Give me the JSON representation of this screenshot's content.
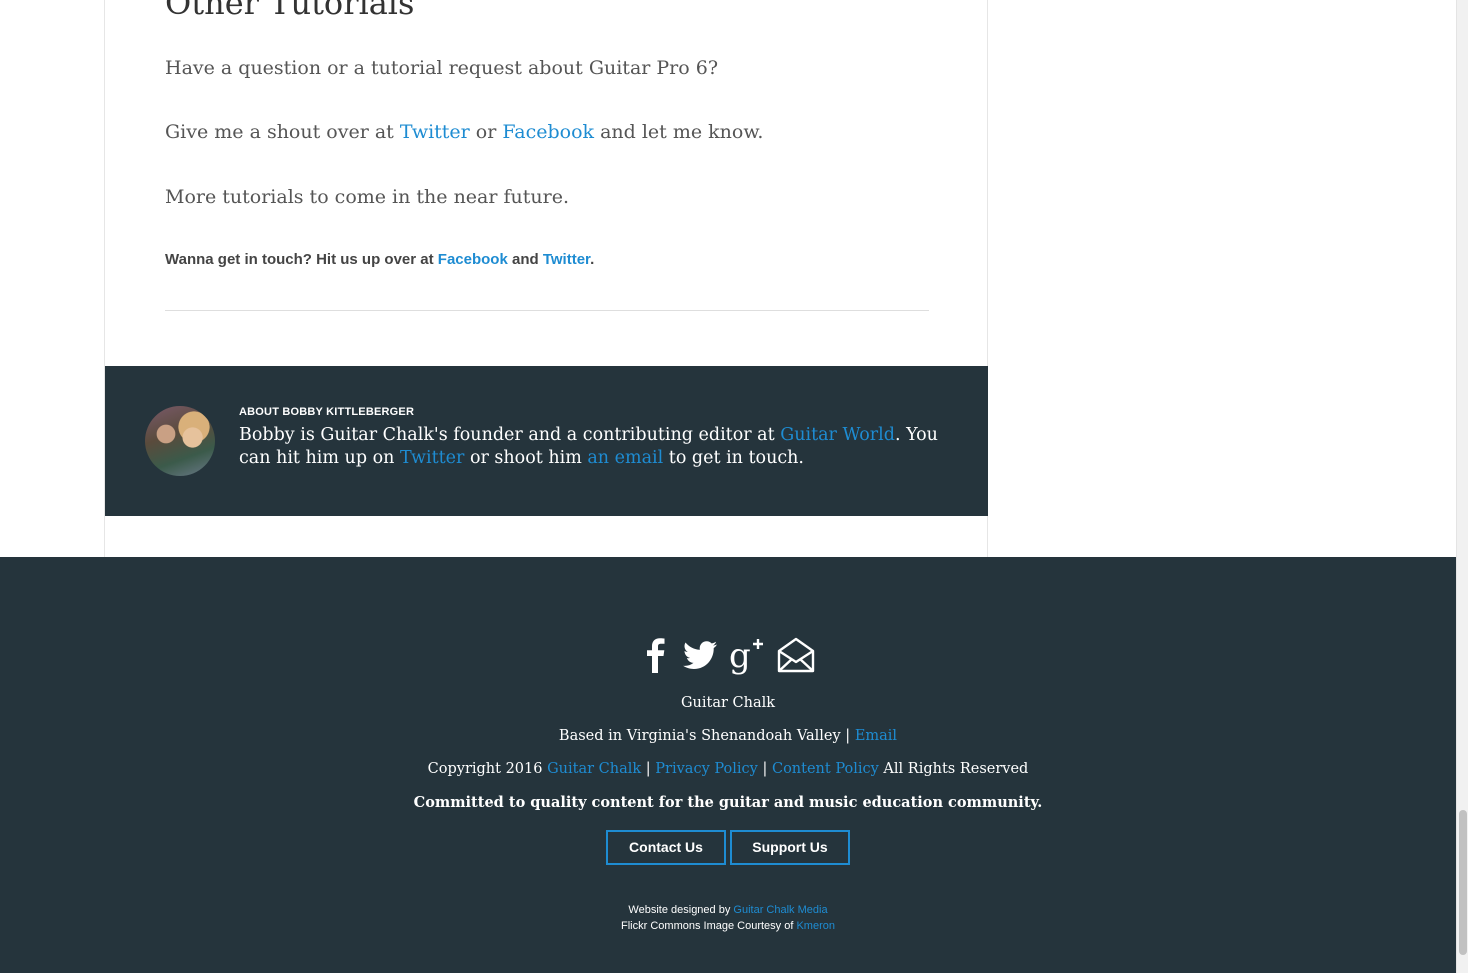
{
  "article": {
    "heading": "Other Tutorials",
    "p1": "Have a question or a tutorial request about Guitar Pro 6?",
    "p2_pre": "Give me a shout over at ",
    "p2_link1": "Twitter",
    "p2_mid": " or ",
    "p2_link2": "Facebook",
    "p2_post": " and let me know.",
    "p3": "More tutorials to come in the near future.",
    "touch_pre": "Wanna get in touch? Hit us up over at ",
    "touch_link1": "Facebook",
    "touch_mid": " and ",
    "touch_link2": "Twitter",
    "touch_post": "."
  },
  "author": {
    "label": "ABOUT BOBBY KITTLEBERGER",
    "bio_pre": "Bobby is Guitar Chalk's founder and a contributing editor at ",
    "bio_link1": "Guitar World",
    "bio_mid1": ". You can hit him up on ",
    "bio_link2": "Twitter",
    "bio_mid2": " or shoot him ",
    "bio_link3": "an email",
    "bio_post": " to get in touch."
  },
  "footer": {
    "site_name": "Guitar Chalk",
    "location_pre": "Based in Virginia's Shenandoah Valley | ",
    "location_link": "Email",
    "copyright_pre": "Copyright 2016 ",
    "copyright_link1": "Guitar Chalk",
    "sep1": " | ",
    "copyright_link2": "Privacy Policy",
    "sep2": " | ",
    "copyright_link3": "Content Policy",
    "copyright_post": " All Rights Reserved",
    "tagline": "Committed to quality content for the guitar and music education community.",
    "contact_button": "Contact Us",
    "support_button": "Support Us",
    "design_pre": "Website designed by ",
    "design_link": "Guitar Chalk Media",
    "flickr_pre": "Flickr Commons Image Courtesy of ",
    "flickr_link": "Kmeron"
  },
  "icons": {
    "social": [
      "facebook-icon",
      "twitter-icon",
      "google-plus-icon",
      "email-icon"
    ]
  },
  "colors": {
    "link": "#1e8cd2",
    "dark_bg": "#25343c"
  }
}
